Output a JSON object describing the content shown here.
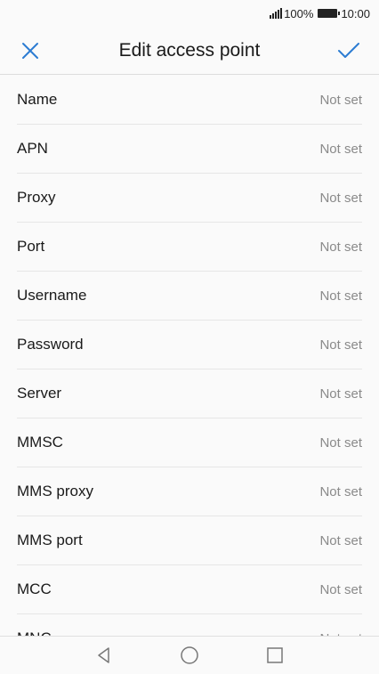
{
  "status_bar": {
    "battery_percent": "100%",
    "time": "10:00",
    "signal_icon": "signal-icon",
    "battery_icon": "battery-icon"
  },
  "header": {
    "title": "Edit access point",
    "close_icon": "close-icon",
    "confirm_icon": "check-icon",
    "accent_color": "#2c7cd2"
  },
  "fields": [
    {
      "label": "Name",
      "value": "Not set"
    },
    {
      "label": "APN",
      "value": "Not set"
    },
    {
      "label": "Proxy",
      "value": "Not set"
    },
    {
      "label": "Port",
      "value": "Not set"
    },
    {
      "label": "Username",
      "value": "Not set"
    },
    {
      "label": "Password",
      "value": "Not set"
    },
    {
      "label": "Server",
      "value": "Not set"
    },
    {
      "label": "MMSC",
      "value": "Not set"
    },
    {
      "label": "MMS proxy",
      "value": "Not set"
    },
    {
      "label": "MMS port",
      "value": "Not set"
    },
    {
      "label": "MCC",
      "value": "Not set"
    },
    {
      "label": "MNC",
      "value": "Not set"
    }
  ],
  "nav_bar": {
    "back_icon": "back-triangle-icon",
    "home_icon": "home-circle-icon",
    "recents_icon": "recents-square-icon"
  }
}
